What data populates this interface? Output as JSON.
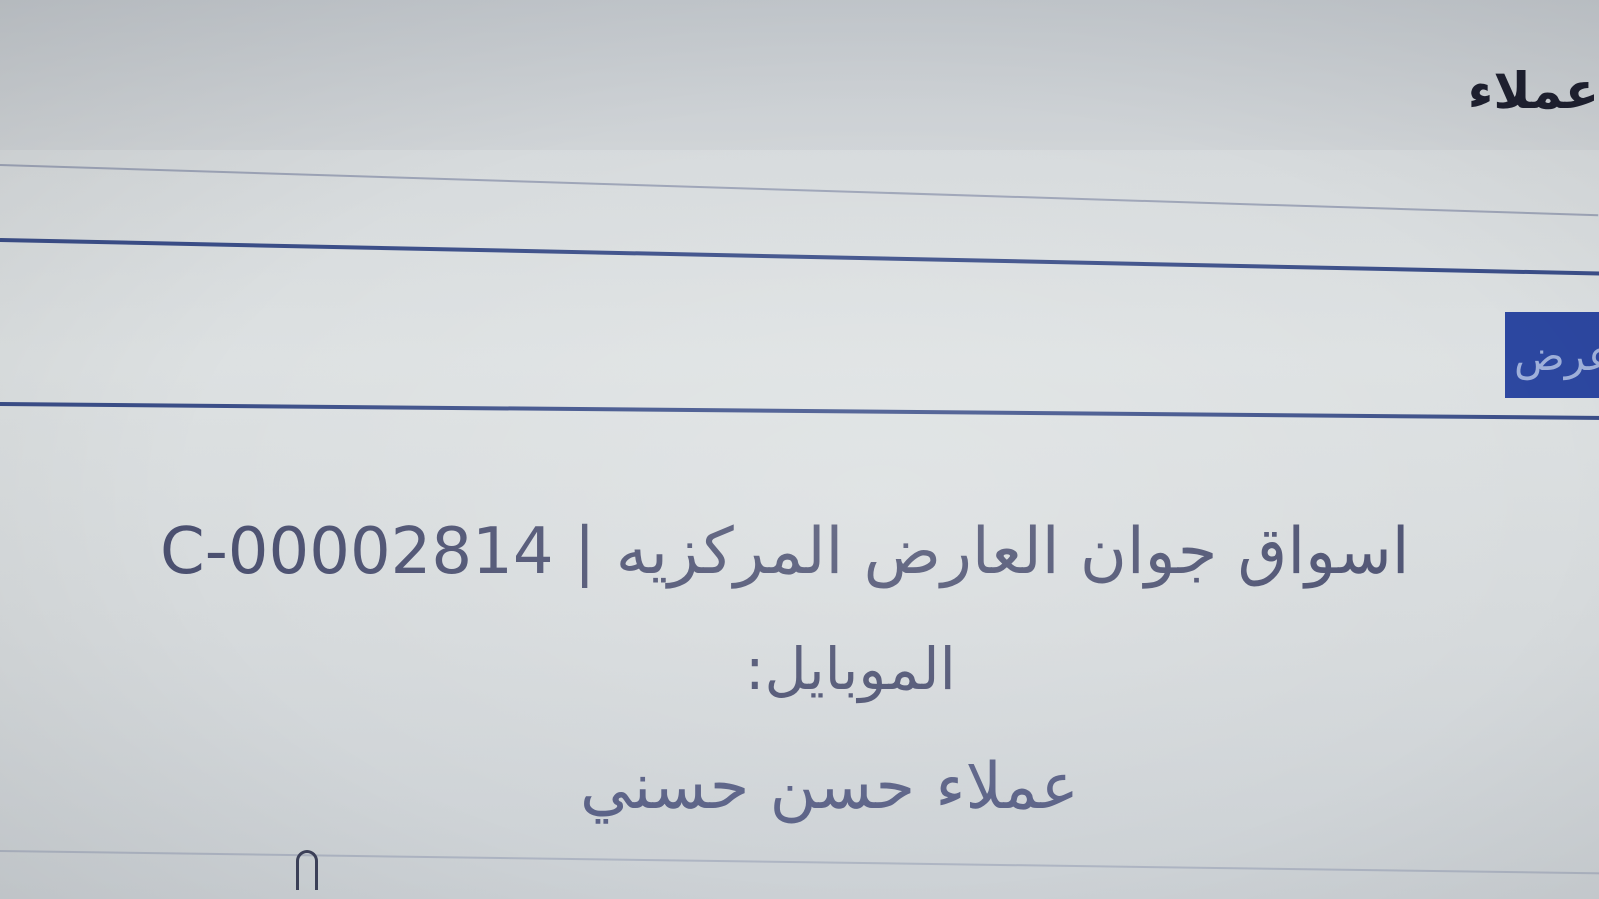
{
  "header": {
    "title": "عملاء"
  },
  "nav": {
    "active_tab_label": "عرض"
  },
  "customer": {
    "store_line": "اسواق جوان العارض المركزيه | C-00002814",
    "mobile_label": "الموبايل:",
    "name": "عملاء حسن حسني"
  },
  "colors": {
    "accent": "#2c47a0",
    "rule": "#3b4e88",
    "text": "#4b5070"
  }
}
